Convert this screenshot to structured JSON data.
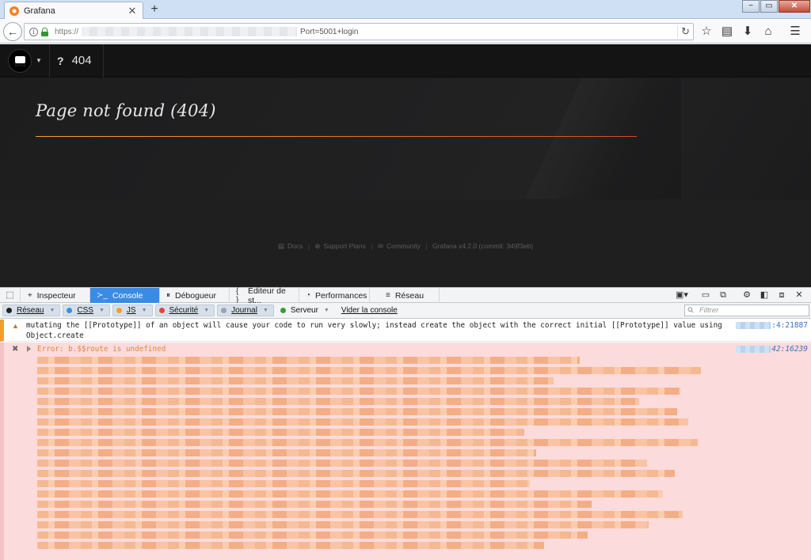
{
  "browser": {
    "tab_title": "Grafana",
    "tab_close": "✕",
    "new_tab": "+",
    "window_controls": {
      "minimize": "−",
      "restore": "▭",
      "close": "✕"
    },
    "url_scheme": "https://",
    "url_rest": "Port=5001+login",
    "nav_icons": {
      "back": "←",
      "info": "i",
      "reload": "↻",
      "bookmark": "☆",
      "reader": "▤",
      "download": "⬇",
      "home": "⌂",
      "menu": "☰"
    }
  },
  "grafana": {
    "breadcrumb_icon": "?",
    "breadcrumb_text": "404",
    "page_title": "Page not found (404)",
    "footer": {
      "docs": "Docs",
      "support": "Support Plans",
      "community": "Community",
      "version": "Grafana v4.2.0 (commit: 349f3eb)",
      "separator": "|"
    }
  },
  "devtools": {
    "tabs": [
      {
        "label": "Inspecteur",
        "icon": "⌖"
      },
      {
        "label": "Console",
        "icon": "≻_"
      },
      {
        "label": "Débogueur",
        "icon": "⏸"
      },
      {
        "label": "Éditeur de st...",
        "icon": "{ }"
      },
      {
        "label": "Performances",
        "icon": "◔"
      },
      {
        "label": "Réseau",
        "icon": "≡"
      }
    ],
    "active_tab": "Console",
    "filters": [
      {
        "label": "Réseau",
        "color": "#222222"
      },
      {
        "label": "CSS",
        "color": "#3b8fe0"
      },
      {
        "label": "JS",
        "color": "#f0a02a"
      },
      {
        "label": "Sécurité",
        "color": "#e0443e"
      },
      {
        "label": "Journal",
        "color": "#9aa4ae"
      },
      {
        "label": "Serveur",
        "color": "#3c9a3c"
      }
    ],
    "clear_label": "Vider la console",
    "filter_placeholder": "Filtrer",
    "messages": {
      "warning_text": "mutating the [[Prototype]] of an object will cause your code to run very slowly; instead create the object with the correct initial [[Prototype]] value using Object.create",
      "warning_location": ":4:21887",
      "error_text": "Error: b.$$route is undefined",
      "error_location": "42:16239"
    }
  }
}
